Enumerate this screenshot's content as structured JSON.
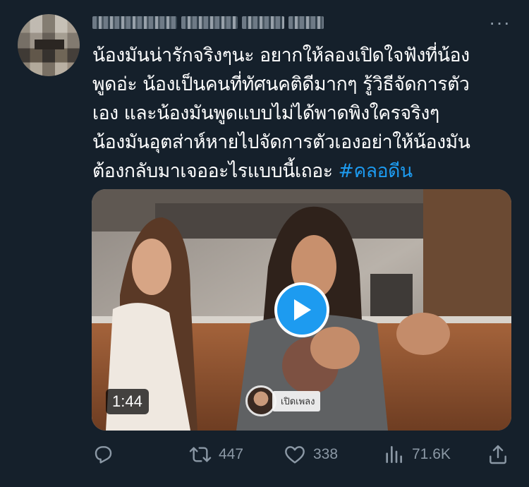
{
  "tweet": {
    "lines": [
      "น้องมันน่ารักจริงๆนะ อยากให้ลองเปิดใจฟังที่น้อง",
      "พูดอ่ะ น้องเป็นคนที่ทัศนคติดีมากๆ รู้วิธีจัดการตัว",
      "เอง และน้องมันพูดแบบไม่ได้พาดพิงใครจริงๆ",
      "น้องมันอุตส่าห์หายไปจัดการตัวเองอย่าให้น้องมัน",
      "ต้องกลับมาเจออะไรแบบนี้เถอะ"
    ],
    "hashtag": "#คลอดีน"
  },
  "media": {
    "duration": "1:44",
    "watermark_label": "เปิดเพลง"
  },
  "actions": {
    "reply_count": "",
    "retweet_count": "447",
    "like_count": "338",
    "views_count": "71.6K"
  },
  "colors": {
    "background": "#15202b",
    "accent": "#1d9bf0",
    "muted": "#8b98a5",
    "text": "#ffffff"
  },
  "icons": {
    "more": "more-icon",
    "reply": "reply-icon",
    "retweet": "retweet-icon",
    "like": "like-icon",
    "views": "views-icon",
    "share": "share-icon",
    "play": "play-icon"
  }
}
